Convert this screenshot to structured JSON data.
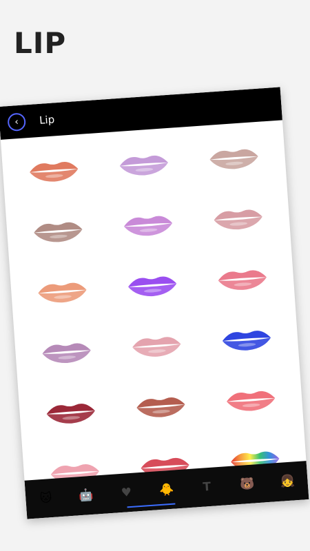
{
  "hero_title": "LIP",
  "appbar": {
    "title": "Lip"
  },
  "lips": [
    {
      "name": "lip-coral",
      "color": "#e07a5f"
    },
    {
      "name": "lip-lilac",
      "color": "#c49bd8"
    },
    {
      "name": "lip-nude-light",
      "color": "#c9a6a0"
    },
    {
      "name": "lip-nude-glossy",
      "color": "#b08c84"
    },
    {
      "name": "lip-lavender",
      "color": "#c98ad8"
    },
    {
      "name": "lip-rose",
      "color": "#d79da4"
    },
    {
      "name": "lip-peach",
      "color": "#ec9b7a"
    },
    {
      "name": "lip-violet",
      "color": "#9a4ef0"
    },
    {
      "name": "lip-pink",
      "color": "#ea7a8c"
    },
    {
      "name": "lip-mauve",
      "color": "#b68ab8"
    },
    {
      "name": "lip-pink-light",
      "color": "#e4a3ae"
    },
    {
      "name": "lip-blue",
      "color": "#2f45e0"
    },
    {
      "name": "lip-burgundy",
      "color": "#9b2838"
    },
    {
      "name": "lip-brown",
      "color": "#b45d4f"
    },
    {
      "name": "lip-salmon",
      "color": "#f0707a"
    },
    {
      "name": "lip-baby-pink",
      "color": "#efa3b0"
    },
    {
      "name": "lip-red-glossy",
      "color": "#d74c5a"
    },
    {
      "name": "lip-rainbow",
      "color": "#3ac08a"
    }
  ],
  "bottom_icons": [
    {
      "name": "cat-sticker-icon",
      "glyph": "🐱"
    },
    {
      "name": "robot-sticker-icon",
      "glyph": "🤖"
    },
    {
      "name": "heart-icon",
      "glyph": "♥"
    },
    {
      "name": "duck-sticker-icon",
      "glyph": "🐥"
    },
    {
      "name": "text-icon",
      "glyph": "T"
    },
    {
      "name": "bear-sticker-icon",
      "glyph": "🐻"
    },
    {
      "name": "girl-sticker-icon",
      "glyph": "👧"
    }
  ]
}
